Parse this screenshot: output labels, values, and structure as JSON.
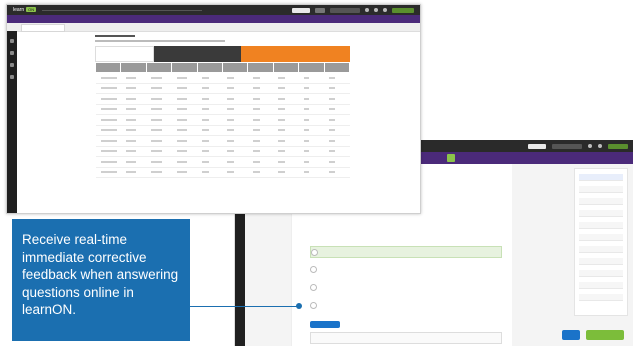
{
  "front_screenshot": {
    "logo_text": "learn",
    "logo_badge": "ON",
    "table_rows": 10,
    "table_cols": 10,
    "colors": {
      "topbar": "#2b2b2b",
      "purple": "#4b2a7a",
      "orange": "#f08221",
      "dark_header": "#3a3a3a",
      "green": "#8bc34a"
    }
  },
  "back_screenshot": {
    "answers_count": 4,
    "sidebar_items": 11,
    "colors": {
      "submit": "#1a73c9",
      "correct_bg": "#e7f2df",
      "bottom_button": "#7cbd3a"
    }
  },
  "callout": {
    "text": "Receive real-time immediate corrective feedback when answering questions online in learnON.",
    "background": "#1b6fb0"
  }
}
